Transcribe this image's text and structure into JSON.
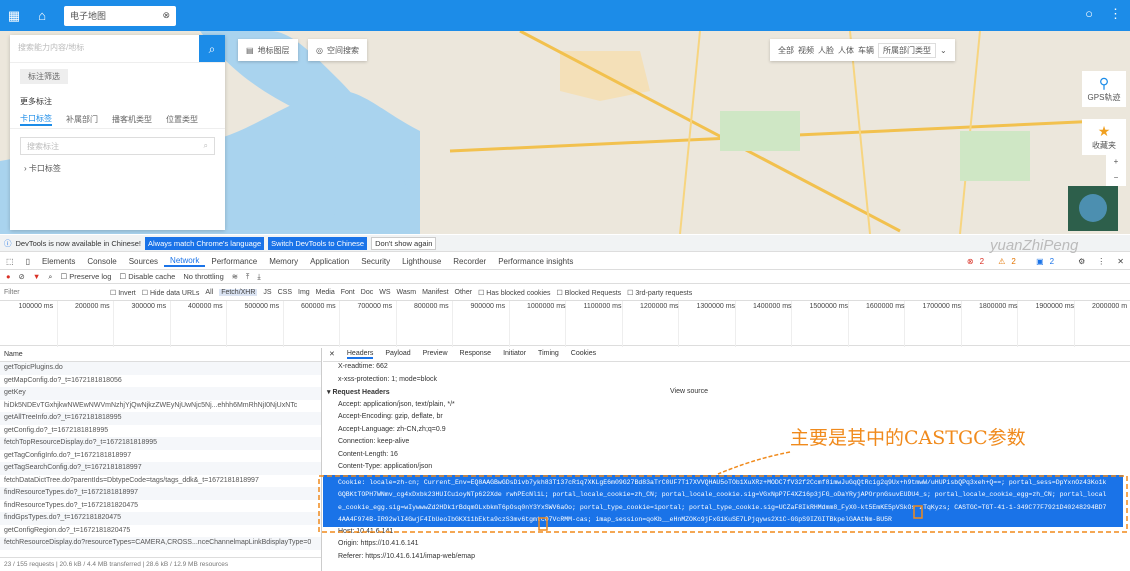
{
  "browser": {
    "tab_title": "电子地图"
  },
  "map": {
    "search_placeholder": "搜索能力内容/地标",
    "chip": "标注筛选",
    "section_title": "更多标注",
    "tabs": [
      "卡口标签",
      "补属部门",
      "播客机类型",
      "位置类型"
    ],
    "sub_search": "搜索标注",
    "tree_item": "卡口标签",
    "toolbar_a": "地标图层",
    "toolbar_b": "空间搜索",
    "filter_items": [
      "全部",
      "视频",
      "人脸",
      "人体",
      "车辆"
    ],
    "filter_select": "所属部门类型",
    "right_gps": "GPS轨迹",
    "right_fav": "收藏夹"
  },
  "devtools": {
    "banner_text": "DevTools is now available in Chinese!",
    "btn_match": "Always match Chrome's language",
    "btn_switch": "Switch DevTools to Chinese",
    "btn_dont": "Don't show again",
    "tabs": [
      "Elements",
      "Console",
      "Sources",
      "Network",
      "Performance",
      "Memory",
      "Application",
      "Security",
      "Lighthouse",
      "Recorder",
      "Performance insights"
    ],
    "network_bar": {
      "preserve": "Preserve log",
      "disable": "Disable cache",
      "throttle": "No throttling"
    },
    "filter": {
      "label": "Filter",
      "invert": "Invert",
      "hide": "Hide data URLs",
      "types": [
        "All",
        "Fetch/XHR",
        "JS",
        "CSS",
        "Img",
        "Media",
        "Font",
        "Doc",
        "WS",
        "Wasm",
        "Manifest",
        "Other"
      ],
      "blocked_cookies": "Has blocked cookies",
      "blocked_req": "Blocked Requests",
      "third": "3rd-party requests"
    },
    "timeline_ticks": [
      "100000 ms",
      "200000 ms",
      "300000 ms",
      "400000 ms",
      "500000 ms",
      "600000 ms",
      "700000 ms",
      "800000 ms",
      "900000 ms",
      "1000000 ms",
      "1100000 ms",
      "1200000 ms",
      "1300000 ms",
      "1400000 ms",
      "1500000 ms",
      "1600000 ms",
      "1700000 ms",
      "1800000 ms",
      "1900000 ms",
      "2000000 m"
    ],
    "requests": {
      "header": "Name",
      "rows": [
        "getTopicPlugins.do",
        "getMapConfig.do?_t=1672181818056",
        "getKey",
        "hiDk5NDEvTGxhjkwNWEwNWVmNzhjYjQwNjkzZWEyNjUwNjc5Nj...ehhh6MmRhNjI0NjUxNTc",
        "getAllTreeInfo.do?_t=1672181818995",
        "getConfig.do?_t=1672181818995",
        "fetchTopResourceDisplay.do?_t=1672181818995",
        "getTagConfigInfo.do?_t=1672181818997",
        "getTagSearchConfig.do?_t=1672181818997",
        "fetchDataDictTree.do?parentIds=DbtypeCode=tags/tags_ddk&_t=1672181818997",
        "findResourceTypes.do?_t=1672181818997",
        "findResourceTypes.do?_t=1672181820475",
        "findGpsTypes.do?_t=1672181820475",
        "getConfigRegion.do?_t=1672181820475",
        "fetchResourceDisplay.do?resourceTypes=CAMERA,CROSS...nceChannelmapLinkBdisplayType=0"
      ],
      "footer": "23 / 155 requests  |  20.6 kB / 4.4 MB transferred  |  28.6 kB / 12.9 MB resources"
    },
    "details": {
      "tabs": [
        "Headers",
        "Payload",
        "Preview",
        "Response",
        "Initiator",
        "Timing",
        "Cookies"
      ],
      "x_readtime": "X-readtime: 662",
      "x_xss": "x-xss-protection: 1; mode=block",
      "req_headers": "▾ Request Headers",
      "view_source": "View source",
      "accept": "Accept: application/json, text/plain, */*",
      "encoding": "Accept-Encoding: gzip, deflate, br",
      "language": "Accept-Language: zh-CN,zh;q=0.9",
      "connection": "Connection: keep-alive",
      "length": "Content-Length: 16",
      "ctype": "Content-Type: application/json",
      "cookie": "Cookie: locale=zh-cn; Current_Env=EQ8AAGBwGDsDivb7ykh83T137cR1q7XKLgE6m09G27Bd83aTrC0UF7T17XVVQHAU5oTOb1XuXRz+MODC7fV32f2Ccmf8imwJuGqQtRcig2q9Ux+h9tmwW/uHUPisbQPq3xeh+Q==; portal_sess=DpYxnOz43Ko1kGQBKtTOPH7WNmv_cg4xDxbk23HUICu1oyNTp622Xde rwhPEcNl1L; portal_locale_cookie=zh_CN; portal_locale_cookie.sig=VGxNpP7F4XZ16p3jFG_oDaYRyjAPOrpnGsuvEUDU4_s; portal_locale_cookie_egg=zh_CN; portal_locale_cookie_egg.sig=wIywwwZd2HDk1rBdqmOLxbkmT6pOsq0nY3YxSWV6aOo; portal_type_cookie=iportal; portal_type_cookie.sig=UCZaF8IkRHMdmm8_FyX0-kt5EmKE5pVSkOs zTqKyzs; CASTGC=TGT-41-1-349C77F7921D40248294BD74AA4F974B-IR92wlI4GwjF4IbUeoIbGKX11bEkta9czS3mv6tgmtcO7VcRMM-cas; imap_session=qoKb__eHnMZOKc9jFxG1KuSE7LPjqyws2X1C-GGpS9IZGITBkpelGAAtNm-BU5R",
      "host": "Host: 10.41.6.141",
      "origin": "Origin: https://10.41.6.141",
      "referer": "Referer: https://10.41.6.141/imap-web/emap"
    },
    "badges": {
      "errors": "2",
      "warnings": "2",
      "info": "2"
    }
  },
  "annotation": "主要是其中的CASTGC参数",
  "watermark": "yuanZhiPeng"
}
